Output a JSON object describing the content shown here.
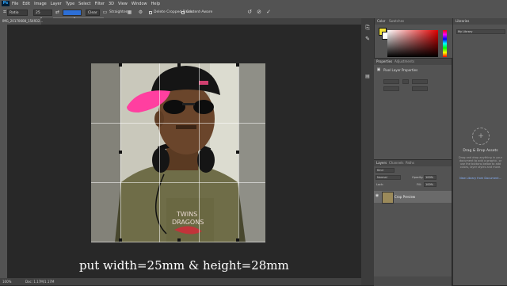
{
  "menu": {
    "app_icon": "Ps",
    "items": [
      "File",
      "Edit",
      "Image",
      "Layer",
      "Type",
      "Select",
      "Filter",
      "3D",
      "View",
      "Window",
      "Help"
    ]
  },
  "options": {
    "ratio_value": "Ratio",
    "width_value": "25",
    "swap_icon": "swap-arrows-icon",
    "clear_label": "Clear",
    "straighten_label": "Straighten",
    "delete_cropped_label": "Delete Cropped Pixels",
    "content_aware_label": "Content-Aware",
    "tooltip_text": "Set the aspect r... for the crop box",
    "reset_icon": "reset-icon",
    "cancel_icon": "cancel-icon",
    "commit_icon": "checkmark-icon"
  },
  "tab": {
    "label": "IMG_20170608_154932..."
  },
  "caption": "put width=25mm & height=28mm",
  "status": {
    "zoom": "100%",
    "doc": "Doc: 1.17M/1.17M"
  },
  "panels": {
    "color_tabs": [
      "Color",
      "Swatches"
    ],
    "properties_tabs": [
      "Properties",
      "Adjustments"
    ],
    "pixel_layer_label": "Pixel Layer Properties",
    "layers_tabs": [
      "Layers",
      "Channels",
      "Paths"
    ],
    "kind_label": "Kind",
    "blend_mode": "Normal",
    "opacity_label": "Opacity:",
    "opacity_value": "100%",
    "lock_label": "Lock:",
    "fill_label": "Fill:",
    "fill_value": "100%",
    "layer_name": "Crop Preview",
    "library_tab": "Libraries",
    "library_select": "My Library",
    "drag_title": "Drag & Drop Assets",
    "drag_desc": "Drag and drop anything in your document to add a graphic, or use the buttons below to add colors, layer styles and more.",
    "new_library": "New Library from Document..."
  },
  "colors": {
    "foreground": "#f3e33a",
    "background": "#ffffff",
    "hat_pink": "#ff3fa0"
  }
}
